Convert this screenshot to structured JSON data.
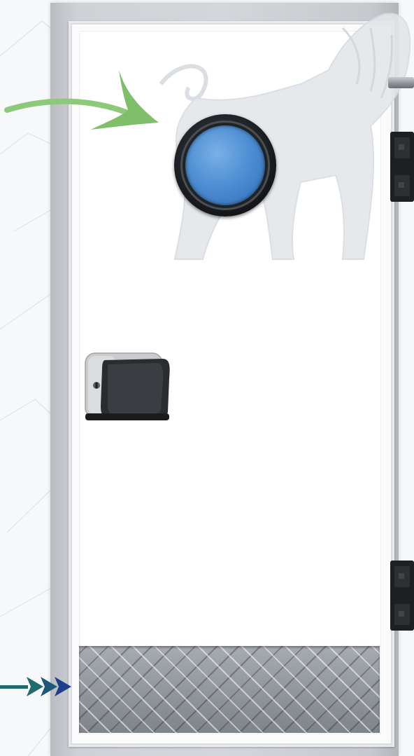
{
  "scene": {
    "subject": "door",
    "colors": {
      "background": "#f7f8fa",
      "frame": "#cfd2d6",
      "door_panel": "#ffffff",
      "porthole_glass": "#4f8fd3",
      "kick_plate": "#8e9398",
      "arrow_top": "#7fbf6a",
      "arrow_bottom": "#1f6b6e"
    },
    "icons": [
      "lion-watermark",
      "porthole-window",
      "door-handle",
      "hinge",
      "kick-plate",
      "pointer-arrow"
    ]
  }
}
